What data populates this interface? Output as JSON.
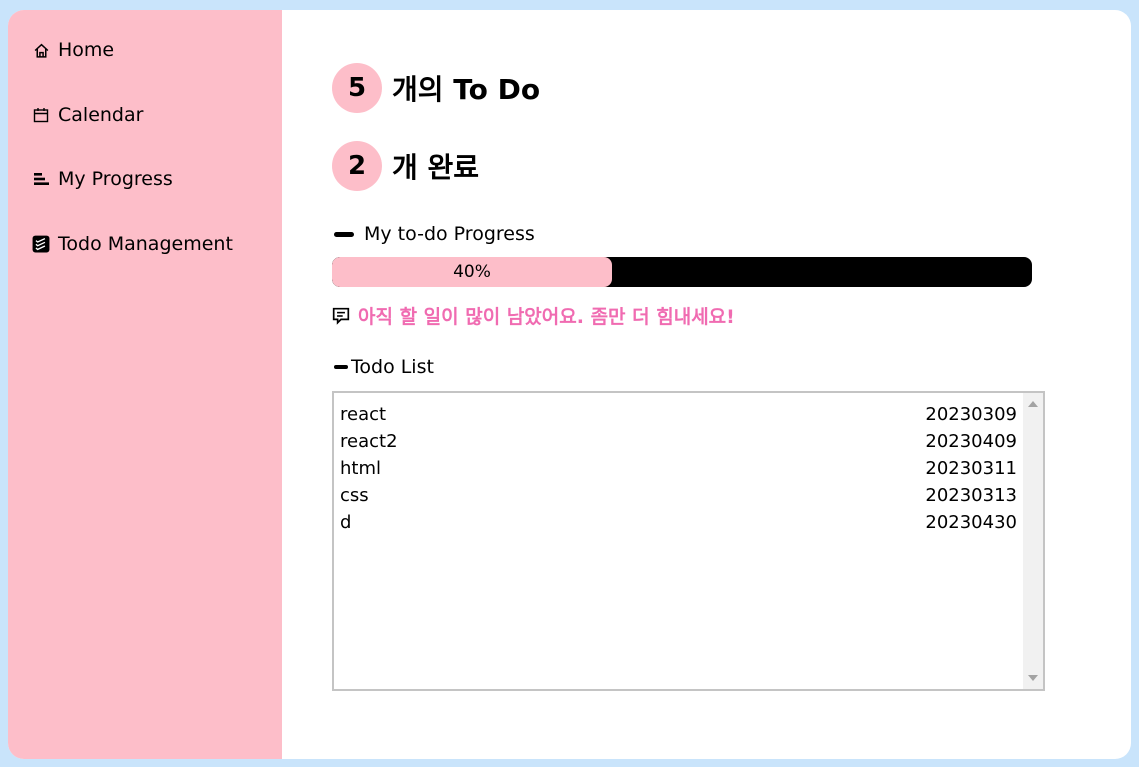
{
  "sidebar": {
    "items": [
      {
        "label": "Home",
        "icon": "home-icon"
      },
      {
        "label": "Calendar",
        "icon": "calendar-icon"
      },
      {
        "label": "My Progress",
        "icon": "progress-bars-icon"
      },
      {
        "label": "Todo Management",
        "icon": "todo-app-icon"
      }
    ]
  },
  "summary": {
    "todo_count": "5",
    "todo_label": "개의 To Do",
    "done_count": "2",
    "done_label": "개 완료"
  },
  "progress": {
    "label": "My to-do Progress",
    "percent_text": "40%",
    "fraction": 0.4,
    "message": "아직 할 일이 많이 남았어요. 좀만 더 힘내세요!"
  },
  "todo_list": {
    "label": "Todo List",
    "items": [
      {
        "name": "react",
        "date": "20230309"
      },
      {
        "name": "react2",
        "date": "20230409"
      },
      {
        "name": "html",
        "date": "20230311"
      },
      {
        "name": "css",
        "date": "20230313"
      },
      {
        "name": "d",
        "date": "20230430"
      }
    ]
  },
  "colors": {
    "background": "#c9e4fb",
    "sidebar": "#fdbec9",
    "accent_text": "#f06bb1",
    "progress_track": "#000000"
  }
}
